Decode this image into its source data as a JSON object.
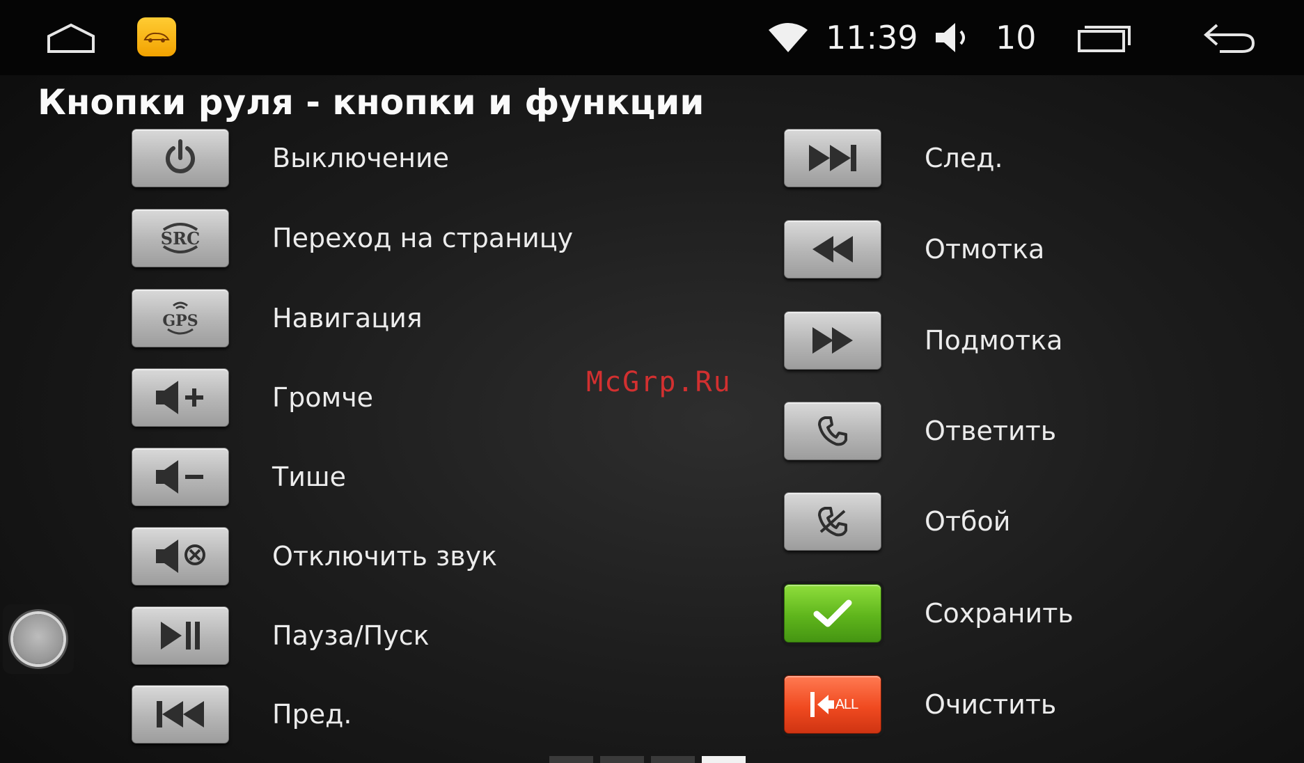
{
  "statusbar": {
    "time": "11:39",
    "volume": "10",
    "icons": [
      "home-icon",
      "app-logo-icon",
      "wifi-icon",
      "volume-icon",
      "recent-apps-icon",
      "back-icon"
    ]
  },
  "page_title": "Кнопки руля - кнопки и функции",
  "watermark": "McGrp.Ru",
  "left_functions": [
    {
      "label": "Выключение",
      "icon": "power-icon"
    },
    {
      "label": "Переход на страницу",
      "icon": "src-icon",
      "icon_text": "SRC"
    },
    {
      "label": "Навигация",
      "icon": "gps-icon",
      "icon_text": "GPS"
    },
    {
      "label": "Громче",
      "icon": "volume-up-icon"
    },
    {
      "label": "Тише",
      "icon": "volume-down-icon"
    },
    {
      "label": "Отключить звук",
      "icon": "mute-icon"
    },
    {
      "label": "Пауза/Пуск",
      "icon": "play-pause-icon"
    },
    {
      "label": "Пред.",
      "icon": "previous-track-icon"
    }
  ],
  "right_functions": [
    {
      "label": "След.",
      "icon": "next-track-icon"
    },
    {
      "label": "Отмотка",
      "icon": "rewind-icon"
    },
    {
      "label": "Подмотка",
      "icon": "fast-forward-icon"
    },
    {
      "label": "Ответить",
      "icon": "phone-answer-icon"
    },
    {
      "label": "Отбой",
      "icon": "phone-hangup-icon"
    },
    {
      "label": "Сохранить",
      "icon": "checkmark-icon"
    },
    {
      "label": "Очистить",
      "icon": "clear-all-icon",
      "icon_text": "ALL"
    }
  ],
  "pager": {
    "count": 4,
    "active_index": 3
  },
  "colors": {
    "save_button": "#5fb51c",
    "clear_button": "#f04a20",
    "watermark": "#d23030"
  }
}
